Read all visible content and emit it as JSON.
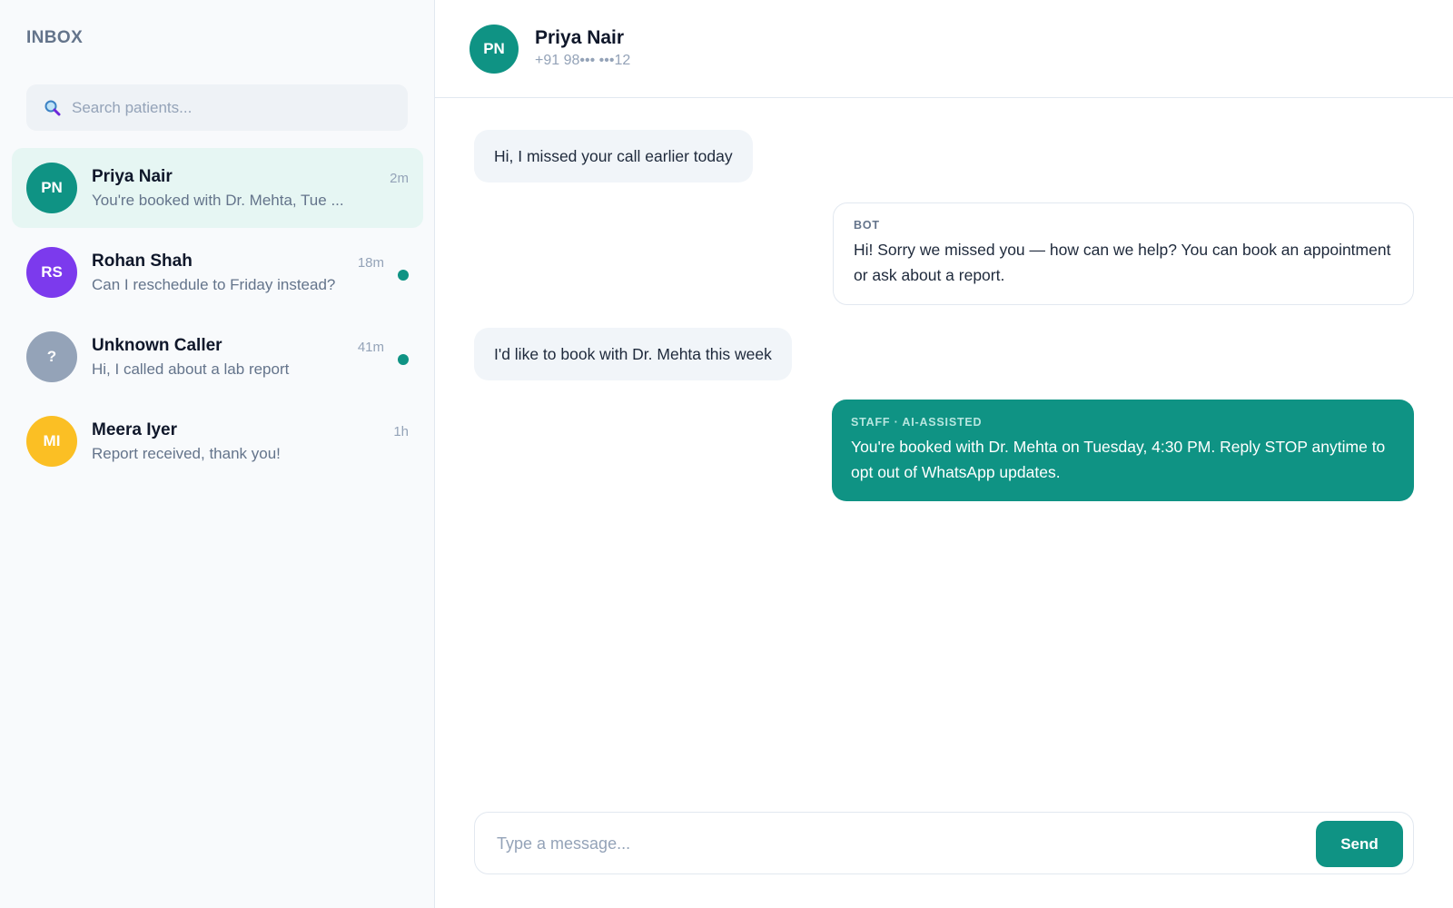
{
  "sidebar": {
    "title": "INBOX",
    "search": {
      "placeholder": "Search patients...",
      "value": ""
    },
    "conversations": [
      {
        "initials": "PN",
        "name": "Priya Nair",
        "preview": "You're booked with Dr. Mehta, Tue ...",
        "time": "2m",
        "unread": false,
        "active": true,
        "avatar_color": "#0f9384"
      },
      {
        "initials": "RS",
        "name": "Rohan Shah",
        "preview": "Can I reschedule to Friday instead?",
        "time": "18m",
        "unread": true,
        "active": false,
        "avatar_color": "#7c3aed"
      },
      {
        "initials": "?",
        "name": "Unknown Caller",
        "preview": "Hi, I called about a lab report",
        "time": "41m",
        "unread": true,
        "active": false,
        "avatar_color": "#94a3b8"
      },
      {
        "initials": "MI",
        "name": "Meera Iyer",
        "preview": "Report received, thank you!",
        "time": "1h",
        "unread": false,
        "active": false,
        "avatar_color": "#fbbf24"
      }
    ]
  },
  "chat": {
    "header": {
      "initials": "PN",
      "name": "Priya Nair",
      "phone": "+91 98••• •••12"
    },
    "messages": [
      {
        "type": "incoming",
        "text": "Hi, I missed your call earlier today"
      },
      {
        "type": "bot",
        "tag": "BOT",
        "text": "Hi! Sorry we missed you — how can we help? You can book an appointment or ask about a report."
      },
      {
        "type": "incoming",
        "text": "I'd like to book with Dr. Mehta this week"
      },
      {
        "type": "staff",
        "tag": "STAFF · AI-ASSISTED",
        "text": "You're booked with Dr. Mehta on Tuesday, 4:30 PM. Reply STOP anytime to opt out of WhatsApp updates."
      }
    ],
    "composer": {
      "placeholder": "Type a message...",
      "value": "",
      "send_label": "Send"
    }
  },
  "colors": {
    "accent": "#0f9384",
    "active_row": "#e6f6f3",
    "sidebar_bg": "#f8fafc",
    "incoming_bubble": "#f1f5f9"
  }
}
